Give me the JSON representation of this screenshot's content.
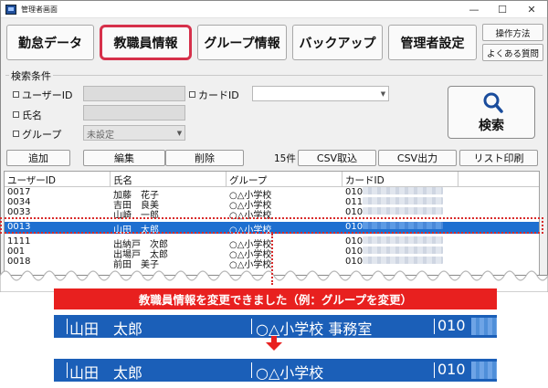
{
  "window": {
    "title": "管理者画面",
    "controls": {
      "minimize": "—",
      "maximize": "☐",
      "close": "✕"
    }
  },
  "nav": {
    "tabs": [
      {
        "label": "勤怠データ",
        "active": false
      },
      {
        "label": "教職員情報",
        "active": true
      },
      {
        "label": "グループ情報",
        "active": false
      },
      {
        "label": "バックアップ",
        "active": false
      },
      {
        "label": "管理者設定",
        "active": false
      }
    ],
    "help": "操作方法",
    "faq": "よくある質問"
  },
  "search": {
    "legend": "検索条件",
    "user_id_label": "ユーザーID",
    "card_id_label": "カードID",
    "name_label": "氏名",
    "group_label": "グループ",
    "group_value": "未設定",
    "button": "検索"
  },
  "actions": {
    "add": "追加",
    "edit": "編集",
    "delete": "削除",
    "count": "15件",
    "csv_import": "CSV取込",
    "csv_export": "CSV出力",
    "print_list": "リスト印刷"
  },
  "table": {
    "columns": [
      "ユーザーID",
      "氏名",
      "グループ",
      "カードID"
    ],
    "rows": [
      {
        "id": "0017",
        "name": "加藤　花子",
        "group": "○△小学校",
        "card": "010"
      },
      {
        "id": "0034",
        "name": "吉田　良美",
        "group": "○△小学校",
        "card": "011"
      },
      {
        "id": "0033",
        "name": "山崎　一郎",
        "group": "○△小学校",
        "card": "010"
      },
      {
        "id": "0013",
        "name": "山田　太郎",
        "group": "○△小学校",
        "card": "010",
        "selected": true
      },
      {
        "id": "1111",
        "name": "出納戸　次郎",
        "group": "○△小学校",
        "card": "010"
      },
      {
        "id": "001",
        "name": "出場戸　太郎",
        "group": "○△小学校",
        "card": "010"
      },
      {
        "id": "0018",
        "name": "前田　美子",
        "group": "○△小学校",
        "card": "010"
      }
    ]
  },
  "callout": {
    "message": "教職員情報を変更できました（例：グループを変更）",
    "before": {
      "name": "山田　太郎",
      "group": "○△小学校 事務室",
      "card": "010"
    },
    "after": {
      "name": "山田　太郎",
      "group": "○△小学校",
      "card": "010"
    }
  },
  "colors": {
    "accent_red": "#e8201f",
    "selection_blue": "#1e6fd0",
    "active_tab_border": "#d6304a"
  }
}
